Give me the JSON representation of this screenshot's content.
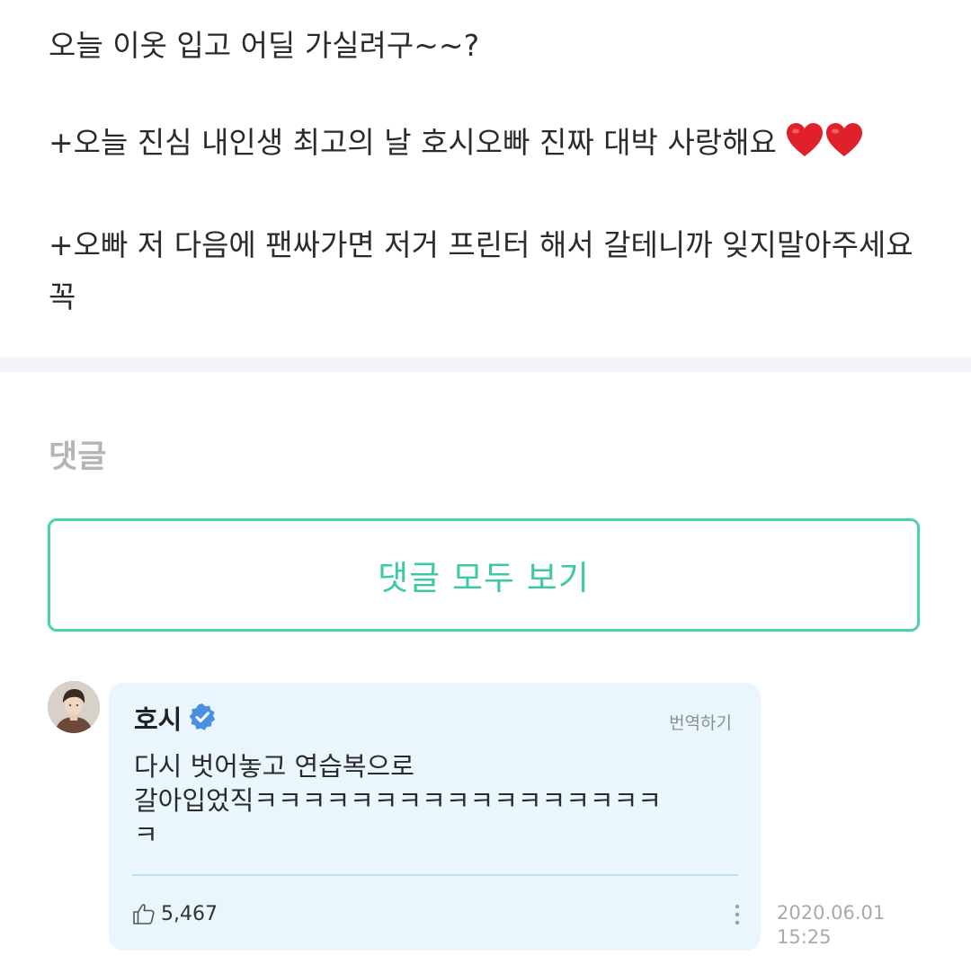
{
  "post": {
    "lines": [
      "오늘 이옷 입고 어딜 가실려구~~?",
      "+오늘 진심 내인생 최고의 날 호시오빠 진짜 대박 사랑해요",
      "+오빠 저 다음에 팬싸가면 저거 프린터 해서 갈테니까 잊지말아주세요",
      "꼭"
    ]
  },
  "comments_section": {
    "title": "댓글",
    "view_all_label": "댓글 모두 보기"
  },
  "comment": {
    "author": "호시",
    "verified": true,
    "translate_label": "번역하기",
    "text_lines": [
      "다시 벗어놓고 연습복으로",
      "갈아입었직ㅋㅋㅋㅋㅋㅋㅋㅋㅋㅋㅋㅋㅋㅋㅋㅋㅋ",
      "ㅋ"
    ],
    "likes": "5,467",
    "timestamp_date": "2020.06.01",
    "timestamp_time": "15:25"
  },
  "colors": {
    "accent": "#3cc9a4",
    "accent_border": "#4fd1b0",
    "comment_bg": "#eaf6fd",
    "verified_blue": "#4a90e2",
    "heart_red": "#e0202a"
  },
  "icons": {
    "heart": "heart-emoji-icon",
    "verified": "verified-badge-icon",
    "like": "thumbs-up-icon",
    "more": "more-vertical-icon",
    "avatar": "user-avatar"
  }
}
